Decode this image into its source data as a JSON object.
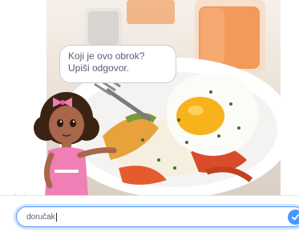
{
  "stage": {
    "photo_icon": "breakfast-plate-photo",
    "speech": {
      "text": "Koji je ovo obrok? Upiši odgovor."
    },
    "sprite_icon": "girl-character"
  },
  "ask": {
    "answer_value": "doručak",
    "submit_icon": "checkmark-icon"
  },
  "colors": {
    "accent": "#4c97ff",
    "text": "#575e75"
  }
}
